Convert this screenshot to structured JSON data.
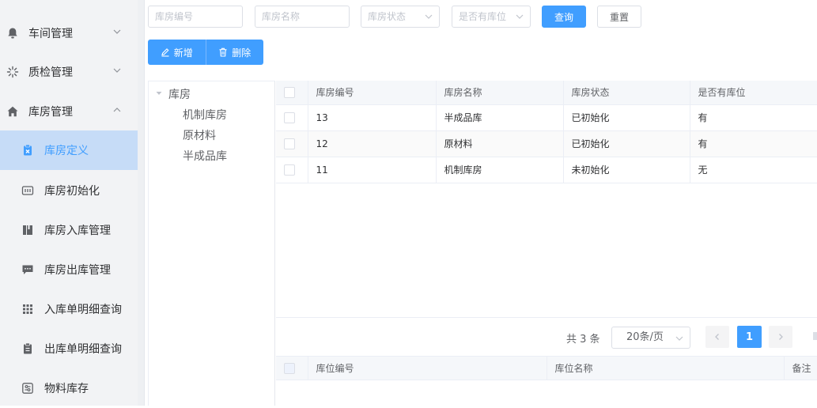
{
  "sidebar": {
    "groups": [
      {
        "label": "车间管理",
        "icon": "bell-icon"
      },
      {
        "label": "质检管理",
        "icon": "loading-icon"
      },
      {
        "label": "库房管理",
        "icon": "home-icon"
      }
    ],
    "items": [
      {
        "label": "库房定义",
        "icon": "clipboard-x-icon",
        "active": true
      },
      {
        "label": "库房初始化",
        "icon": "chip-icon"
      },
      {
        "label": "库房入库管理",
        "icon": "book-icon"
      },
      {
        "label": "库房出库管理",
        "icon": "chat-icon"
      },
      {
        "label": "入库单明细查询",
        "icon": "grid-icon"
      },
      {
        "label": "出库单明细查询",
        "icon": "clipboard-icon"
      },
      {
        "label": "物料库存",
        "icon": "sliders-icon"
      }
    ]
  },
  "search": {
    "code_placeholder": "库房编号",
    "name_placeholder": "库房名称",
    "status_placeholder": "库房状态",
    "location_placeholder": "是否有库位",
    "query_label": "查询",
    "reset_label": "重置"
  },
  "actions": {
    "add_label": "新增",
    "delete_label": "删除"
  },
  "tree": {
    "root": "库房",
    "children": [
      "机制库房",
      "原材料",
      "半成品库"
    ]
  },
  "table": {
    "columns": [
      "库房编号",
      "库房名称",
      "库房状态",
      "是否有库位"
    ],
    "rows": [
      {
        "code": "13",
        "name": "半成品库",
        "status": "已初始化",
        "has_location": "有"
      },
      {
        "code": "12",
        "name": "原材料",
        "status": "已初始化",
        "has_location": "有"
      },
      {
        "code": "11",
        "name": "机制库房",
        "status": "未初始化",
        "has_location": "无"
      }
    ]
  },
  "pagination": {
    "total": "共 3 条",
    "page_size": "20条/页",
    "current_page": "1"
  },
  "sub_table": {
    "columns": [
      "库位编号",
      "库位名称",
      "备注"
    ]
  },
  "colors": {
    "primary": "#409eff",
    "active_bg": "#c6dcf7",
    "sidebar_bg": "#f2f3f5"
  }
}
